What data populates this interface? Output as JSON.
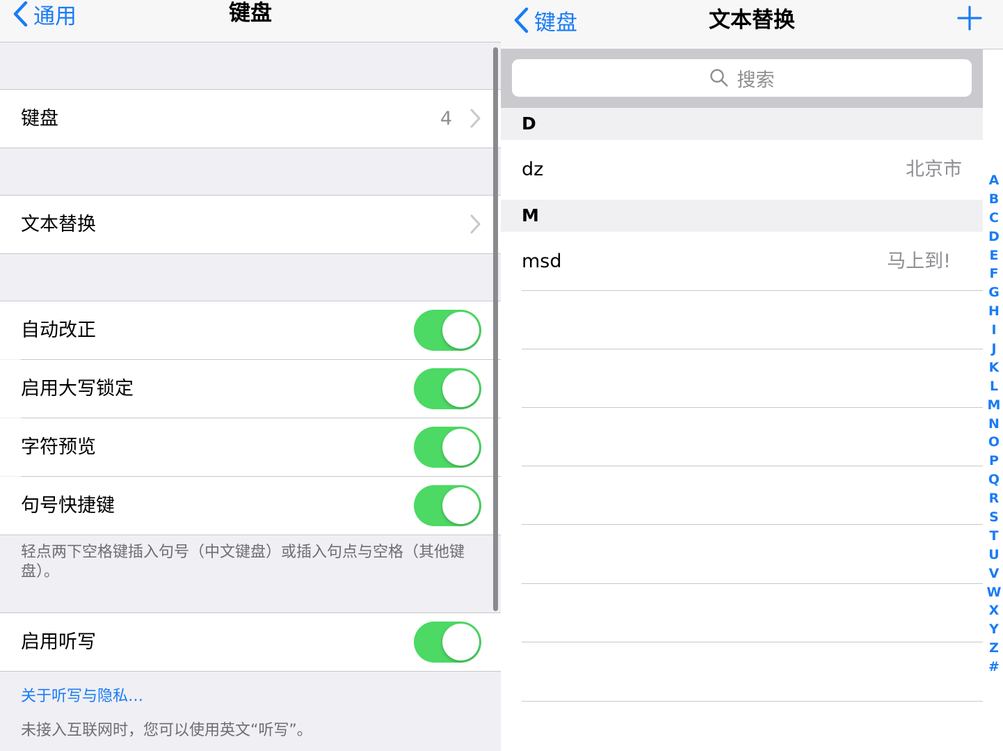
{
  "left": {
    "nav": {
      "back_label": "通用",
      "title": "键盘"
    },
    "keyboards": {
      "label": "键盘",
      "count": "4"
    },
    "text_replacement": {
      "label": "文本替换"
    },
    "toggles": [
      {
        "label": "自动改正",
        "on": true
      },
      {
        "label": "启用大写锁定",
        "on": true
      },
      {
        "label": "字符预览",
        "on": true
      },
      {
        "label": "句号快捷键",
        "on": true
      }
    ],
    "period_note": "轻点两下空格键插入句号（中文键盘）或插入句点与空格（其他键盘）。",
    "dictation": {
      "label": "启用听写",
      "on": true
    },
    "dictation_link": "关于听写与隐私…",
    "dictation_note": "未接入互联网时，您可以使用英文“听写”。"
  },
  "right": {
    "nav": {
      "back_label": "键盘",
      "title": "文本替换",
      "add_icon": "plus-icon"
    },
    "search": {
      "placeholder": "搜索"
    },
    "sections": [
      {
        "header": "D",
        "items": [
          {
            "shortcut": "dz",
            "phrase": "北京市"
          }
        ]
      },
      {
        "header": "M",
        "items": [
          {
            "shortcut": "msd",
            "phrase": "马上到!"
          }
        ]
      }
    ],
    "index": [
      "A",
      "B",
      "C",
      "D",
      "E",
      "F",
      "G",
      "H",
      "I",
      "J",
      "K",
      "L",
      "M",
      "N",
      "O",
      "P",
      "Q",
      "R",
      "S",
      "T",
      "U",
      "V",
      "W",
      "X",
      "Y",
      "Z",
      "#"
    ]
  },
  "colors": {
    "accent": "#1a7cf5",
    "toggle_on": "#4cd964",
    "grouped_bg": "#efeff4"
  }
}
